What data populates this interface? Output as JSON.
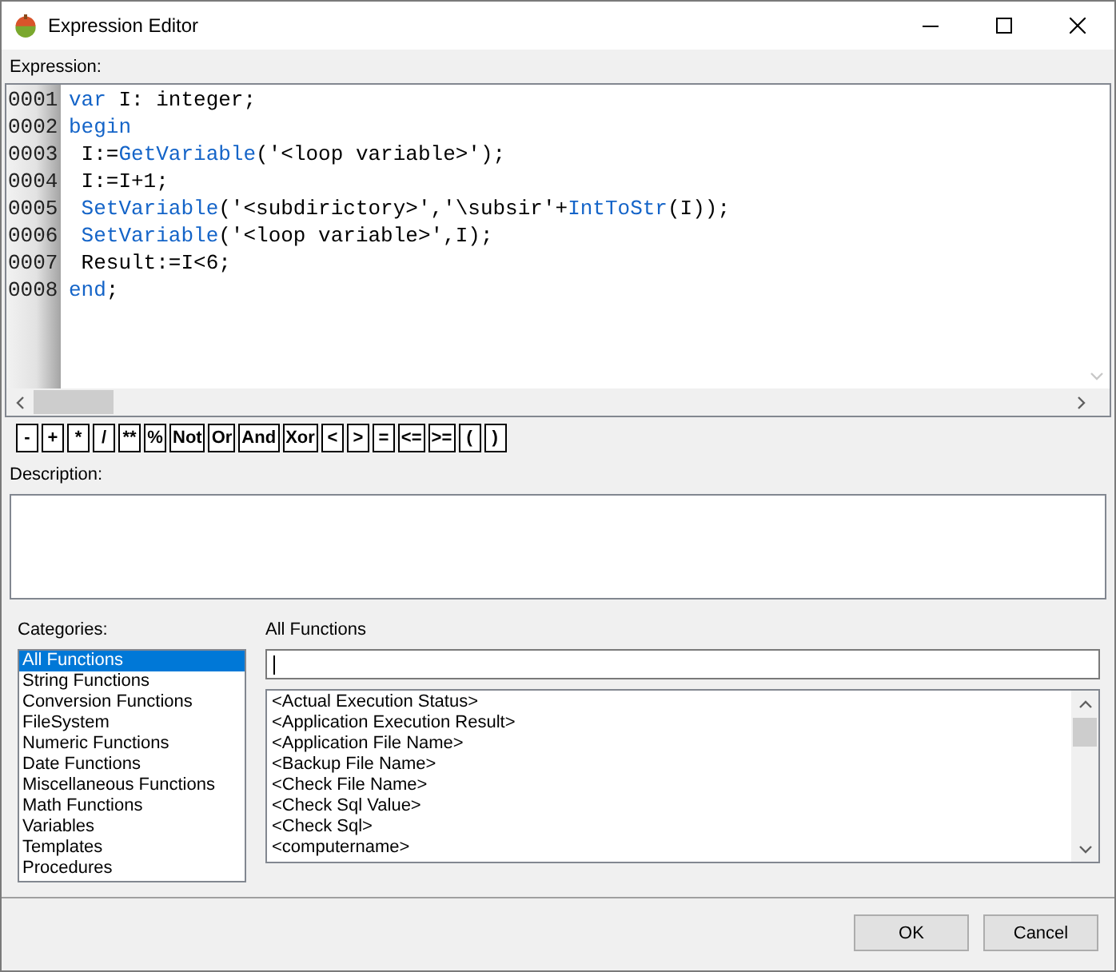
{
  "window": {
    "title": "Expression Editor"
  },
  "expression": {
    "label": "Expression:",
    "lines": [
      {
        "number": "0001",
        "tokens": [
          {
            "text": "var",
            "kind": "keyword"
          },
          {
            "text": " I: integer;",
            "kind": "plain"
          }
        ]
      },
      {
        "number": "0002",
        "tokens": [
          {
            "text": "begin",
            "kind": "keyword"
          }
        ]
      },
      {
        "number": "0003",
        "tokens": [
          {
            "text": " I:=",
            "kind": "plain"
          },
          {
            "text": "GetVariable",
            "kind": "function"
          },
          {
            "text": "('<loop variable>');",
            "kind": "plain"
          }
        ]
      },
      {
        "number": "0004",
        "tokens": [
          {
            "text": " I:=I+1;",
            "kind": "plain"
          }
        ]
      },
      {
        "number": "0005",
        "tokens": [
          {
            "text": " SetVariable",
            "kind": "function"
          },
          {
            "text": "('<subdirictory>','\\subsir'+",
            "kind": "plain"
          },
          {
            "text": "IntToStr",
            "kind": "function"
          },
          {
            "text": "(I));",
            "kind": "plain"
          }
        ]
      },
      {
        "number": "0006",
        "tokens": [
          {
            "text": " SetVariable",
            "kind": "function"
          },
          {
            "text": "('<loop variable>',I);",
            "kind": "plain"
          }
        ]
      },
      {
        "number": "0007",
        "tokens": [
          {
            "text": " Result:=I<6;",
            "kind": "plain"
          }
        ]
      },
      {
        "number": "0008",
        "tokens": [
          {
            "text": "end",
            "kind": "keyword"
          },
          {
            "text": ";",
            "kind": "plain"
          }
        ]
      }
    ]
  },
  "operators": [
    "-",
    "+",
    "*",
    "/",
    "**",
    "%",
    "Not",
    "Or",
    "And",
    "Xor",
    "<",
    ">",
    "=",
    "<=",
    ">=",
    "(",
    ")"
  ],
  "description": {
    "label": "Description:"
  },
  "categories": {
    "label": "Categories:",
    "items": [
      {
        "label": "All Functions",
        "selected": true
      },
      {
        "label": "String Functions",
        "selected": false
      },
      {
        "label": "Conversion Functions",
        "selected": false
      },
      {
        "label": "FileSystem",
        "selected": false
      },
      {
        "label": "Numeric Functions",
        "selected": false
      },
      {
        "label": "Date Functions",
        "selected": false
      },
      {
        "label": "Miscellaneous Functions",
        "selected": false
      },
      {
        "label": "Math Functions",
        "selected": false
      },
      {
        "label": "Variables",
        "selected": false
      },
      {
        "label": "Templates",
        "selected": false
      },
      {
        "label": "Procedures",
        "selected": false
      }
    ]
  },
  "functions": {
    "label": "All Functions",
    "search_field": {
      "focused": true
    },
    "items": [
      {
        "label": "<Actual Execution Status>",
        "selected": false
      },
      {
        "label": "<Application Execution Result>",
        "selected": false
      },
      {
        "label": "<Application File Name>",
        "selected": false
      },
      {
        "label": "<Backup File Name>",
        "selected": false
      },
      {
        "label": "<Check File Name>",
        "selected": false
      },
      {
        "label": "<Check Sql Value>",
        "selected": false
      },
      {
        "label": "<Check Sql>",
        "selected": false
      },
      {
        "label": "<computername>",
        "selected": false
      }
    ]
  },
  "buttons": [
    "OK",
    "Cancel"
  ]
}
